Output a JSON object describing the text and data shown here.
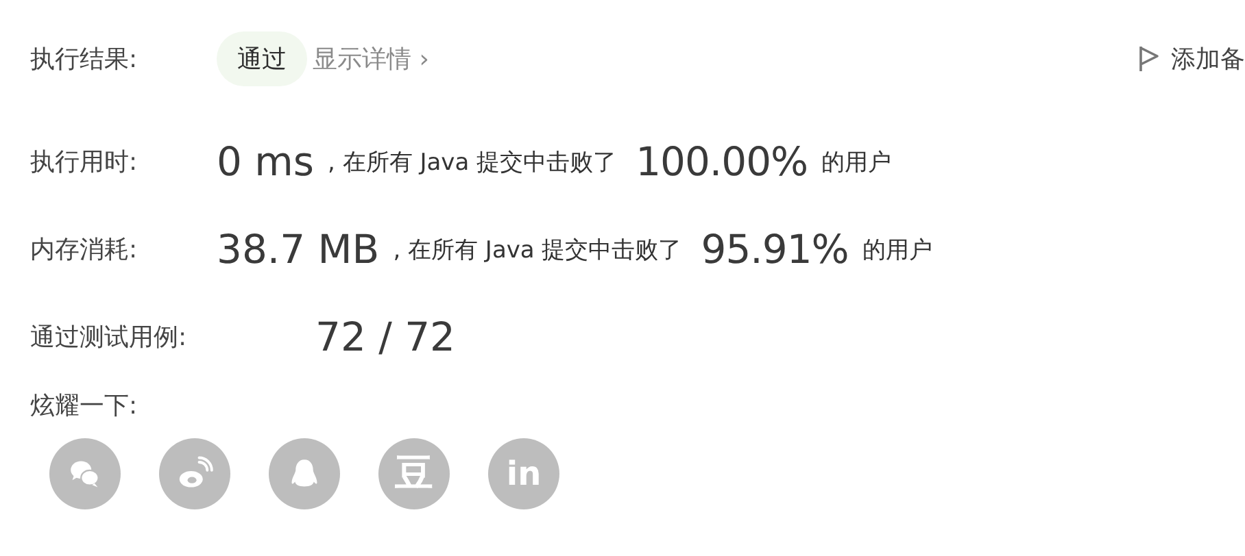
{
  "result": {
    "label": "执行结果:",
    "status": "通过",
    "details_link": "显示详情",
    "details_caret": "›",
    "add_note": "添加备"
  },
  "stats": [
    {
      "kind": "beat",
      "label": "执行用时:",
      "value": "0 ms",
      "text": ", 在所有 Java 提交中击败了",
      "percent": "100.00%",
      "suffix": "的用户"
    },
    {
      "kind": "beat",
      "label": "内存消耗:",
      "value": "38.7 MB",
      "text": ", 在所有 Java 提交中击败了",
      "percent": "95.91%",
      "suffix": "的用户"
    },
    {
      "kind": "cases",
      "label": "通过测试用例:",
      "value": "72 / 72"
    }
  ],
  "share": {
    "label": "炫耀一下:",
    "buttons": [
      {
        "kind": "wechat"
      },
      {
        "kind": "weibo"
      },
      {
        "kind": "qq"
      },
      {
        "kind": "douban",
        "glyph": "豆"
      },
      {
        "kind": "linkedin",
        "glyph": "in"
      }
    ]
  }
}
